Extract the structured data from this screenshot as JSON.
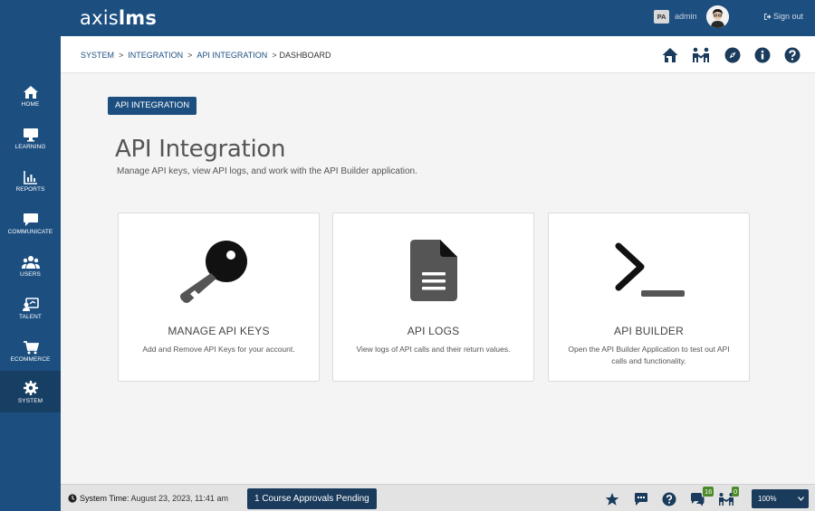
{
  "app": {
    "logo_prefix": "axis",
    "logo_suffix": "lms"
  },
  "sidebar": {
    "items": [
      {
        "label": "HOME",
        "icon": "home-icon"
      },
      {
        "label": "LEARNING",
        "icon": "monitor-icon"
      },
      {
        "label": "REPORTS",
        "icon": "bar-chart-icon"
      },
      {
        "label": "COMMUNICATE",
        "icon": "chat-bubble-icon"
      },
      {
        "label": "USERS",
        "icon": "users-icon"
      },
      {
        "label": "TALENT",
        "icon": "talent-icon"
      },
      {
        "label": "ECOMMERCE",
        "icon": "cart-icon"
      },
      {
        "label": "SYSTEM",
        "icon": "gear-icon",
        "active": true
      }
    ]
  },
  "header": {
    "user_initials": "PA",
    "user_name": "admin",
    "sign_out": "Sign out"
  },
  "breadcrumb": {
    "items": [
      "SYSTEM",
      "INTEGRATION",
      "API INTEGRATION",
      "DASHBOARD"
    ],
    "separator": ">"
  },
  "main": {
    "tag": "API INTEGRATION",
    "title": "API Integration",
    "subtitle": "Manage API keys, view API logs, and work with the API Builder application.",
    "cards": [
      {
        "title": "MANAGE API KEYS",
        "description": "Add and Remove API Keys for your account.",
        "icon": "key-icon"
      },
      {
        "title": "API LOGS",
        "description": "View logs of API calls and their return values.",
        "icon": "document-icon"
      },
      {
        "title": "API BUILDER",
        "description": "Open the API Builder Application to test out API calls and functionality.",
        "icon": "terminal-icon"
      }
    ]
  },
  "footer": {
    "system_time_label": "System Time:",
    "system_time_value": "August 23, 2023, 11:41 am",
    "pending_button": "1 Course Approvals Pending",
    "chat_count": "16",
    "handshake_count": "0",
    "zoom": "100%"
  },
  "colors": {
    "brand": "#1c4f80",
    "dark_button": "#1a3b5c",
    "badge_green": "#4b8a2a"
  }
}
